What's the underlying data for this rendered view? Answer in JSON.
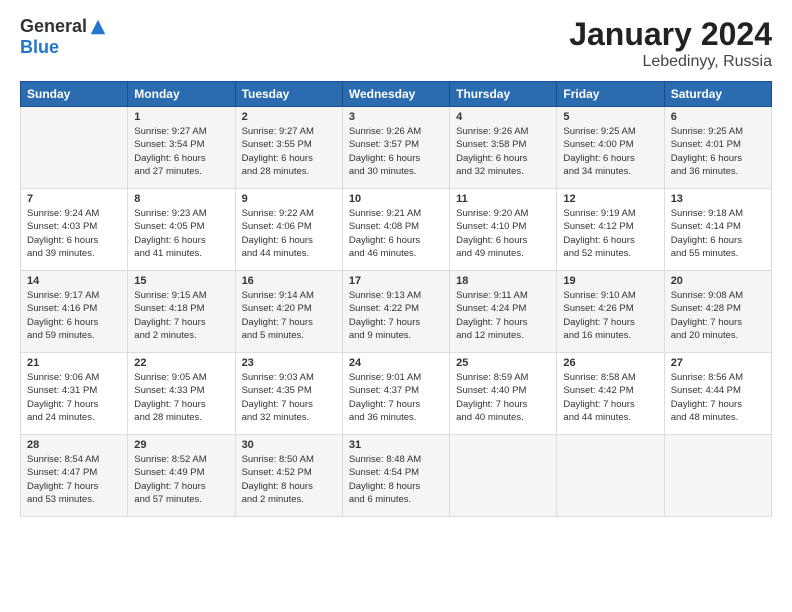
{
  "logo": {
    "general": "General",
    "blue": "Blue"
  },
  "header": {
    "month": "January 2024",
    "location": "Lebedinyy, Russia"
  },
  "weekdays": [
    "Sunday",
    "Monday",
    "Tuesday",
    "Wednesday",
    "Thursday",
    "Friday",
    "Saturday"
  ],
  "weeks": [
    [
      {
        "day": "",
        "info": ""
      },
      {
        "day": "1",
        "info": "Sunrise: 9:27 AM\nSunset: 3:54 PM\nDaylight: 6 hours\nand 27 minutes."
      },
      {
        "day": "2",
        "info": "Sunrise: 9:27 AM\nSunset: 3:55 PM\nDaylight: 6 hours\nand 28 minutes."
      },
      {
        "day": "3",
        "info": "Sunrise: 9:26 AM\nSunset: 3:57 PM\nDaylight: 6 hours\nand 30 minutes."
      },
      {
        "day": "4",
        "info": "Sunrise: 9:26 AM\nSunset: 3:58 PM\nDaylight: 6 hours\nand 32 minutes."
      },
      {
        "day": "5",
        "info": "Sunrise: 9:25 AM\nSunset: 4:00 PM\nDaylight: 6 hours\nand 34 minutes."
      },
      {
        "day": "6",
        "info": "Sunrise: 9:25 AM\nSunset: 4:01 PM\nDaylight: 6 hours\nand 36 minutes."
      }
    ],
    [
      {
        "day": "7",
        "info": "Sunrise: 9:24 AM\nSunset: 4:03 PM\nDaylight: 6 hours\nand 39 minutes."
      },
      {
        "day": "8",
        "info": "Sunrise: 9:23 AM\nSunset: 4:05 PM\nDaylight: 6 hours\nand 41 minutes."
      },
      {
        "day": "9",
        "info": "Sunrise: 9:22 AM\nSunset: 4:06 PM\nDaylight: 6 hours\nand 44 minutes."
      },
      {
        "day": "10",
        "info": "Sunrise: 9:21 AM\nSunset: 4:08 PM\nDaylight: 6 hours\nand 46 minutes."
      },
      {
        "day": "11",
        "info": "Sunrise: 9:20 AM\nSunset: 4:10 PM\nDaylight: 6 hours\nand 49 minutes."
      },
      {
        "day": "12",
        "info": "Sunrise: 9:19 AM\nSunset: 4:12 PM\nDaylight: 6 hours\nand 52 minutes."
      },
      {
        "day": "13",
        "info": "Sunrise: 9:18 AM\nSunset: 4:14 PM\nDaylight: 6 hours\nand 55 minutes."
      }
    ],
    [
      {
        "day": "14",
        "info": "Sunrise: 9:17 AM\nSunset: 4:16 PM\nDaylight: 6 hours\nand 59 minutes."
      },
      {
        "day": "15",
        "info": "Sunrise: 9:15 AM\nSunset: 4:18 PM\nDaylight: 7 hours\nand 2 minutes."
      },
      {
        "day": "16",
        "info": "Sunrise: 9:14 AM\nSunset: 4:20 PM\nDaylight: 7 hours\nand 5 minutes."
      },
      {
        "day": "17",
        "info": "Sunrise: 9:13 AM\nSunset: 4:22 PM\nDaylight: 7 hours\nand 9 minutes."
      },
      {
        "day": "18",
        "info": "Sunrise: 9:11 AM\nSunset: 4:24 PM\nDaylight: 7 hours\nand 12 minutes."
      },
      {
        "day": "19",
        "info": "Sunrise: 9:10 AM\nSunset: 4:26 PM\nDaylight: 7 hours\nand 16 minutes."
      },
      {
        "day": "20",
        "info": "Sunrise: 9:08 AM\nSunset: 4:28 PM\nDaylight: 7 hours\nand 20 minutes."
      }
    ],
    [
      {
        "day": "21",
        "info": "Sunrise: 9:06 AM\nSunset: 4:31 PM\nDaylight: 7 hours\nand 24 minutes."
      },
      {
        "day": "22",
        "info": "Sunrise: 9:05 AM\nSunset: 4:33 PM\nDaylight: 7 hours\nand 28 minutes."
      },
      {
        "day": "23",
        "info": "Sunrise: 9:03 AM\nSunset: 4:35 PM\nDaylight: 7 hours\nand 32 minutes."
      },
      {
        "day": "24",
        "info": "Sunrise: 9:01 AM\nSunset: 4:37 PM\nDaylight: 7 hours\nand 36 minutes."
      },
      {
        "day": "25",
        "info": "Sunrise: 8:59 AM\nSunset: 4:40 PM\nDaylight: 7 hours\nand 40 minutes."
      },
      {
        "day": "26",
        "info": "Sunrise: 8:58 AM\nSunset: 4:42 PM\nDaylight: 7 hours\nand 44 minutes."
      },
      {
        "day": "27",
        "info": "Sunrise: 8:56 AM\nSunset: 4:44 PM\nDaylight: 7 hours\nand 48 minutes."
      }
    ],
    [
      {
        "day": "28",
        "info": "Sunrise: 8:54 AM\nSunset: 4:47 PM\nDaylight: 7 hours\nand 53 minutes."
      },
      {
        "day": "29",
        "info": "Sunrise: 8:52 AM\nSunset: 4:49 PM\nDaylight: 7 hours\nand 57 minutes."
      },
      {
        "day": "30",
        "info": "Sunrise: 8:50 AM\nSunset: 4:52 PM\nDaylight: 8 hours\nand 2 minutes."
      },
      {
        "day": "31",
        "info": "Sunrise: 8:48 AM\nSunset: 4:54 PM\nDaylight: 8 hours\nand 6 minutes."
      },
      {
        "day": "",
        "info": ""
      },
      {
        "day": "",
        "info": ""
      },
      {
        "day": "",
        "info": ""
      }
    ]
  ]
}
